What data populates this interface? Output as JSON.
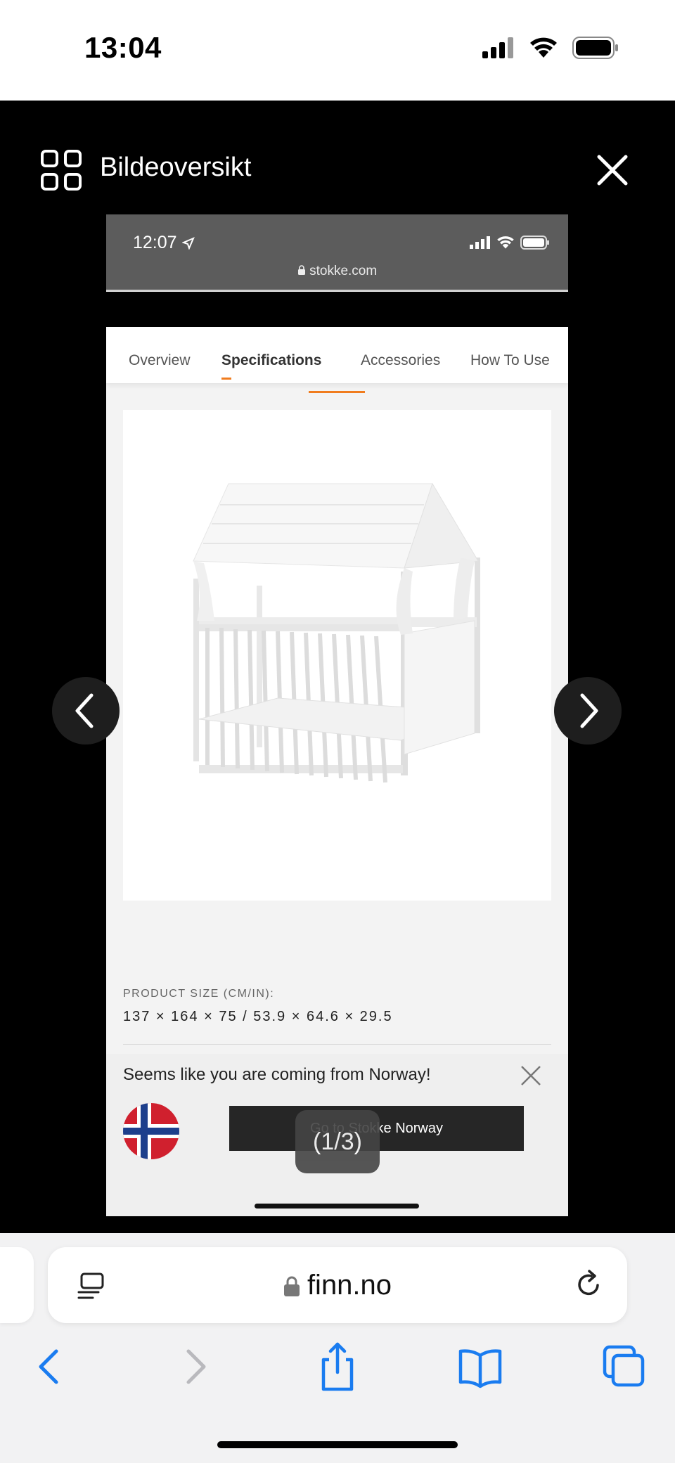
{
  "status_bar": {
    "time": "13:04"
  },
  "gallery": {
    "title": "Bildeoversikt",
    "counter": "(1/3)"
  },
  "screenshot": {
    "status_time": "12:07",
    "url": "stokke.com",
    "tabs": [
      "Overview",
      "Specifications",
      "Accessories",
      "How To Use"
    ],
    "active_tab": "Specifications",
    "spec_label": "PRODUCT SIZE (CM/IN):",
    "spec_value": "137 × 164 × 75 / 53.9 × 64.6 × 29.5",
    "banner_text": "Seems like you are coming from Norway!",
    "banner_button": "Go to Stokke Norway",
    "accent_color": "#f07c1e"
  },
  "browser": {
    "address": "finn.no",
    "toolbar_icons": [
      "back-icon",
      "forward-icon",
      "share-icon",
      "bookmarks-icon",
      "tabs-icon"
    ],
    "accent_color": "#1a7cf0"
  }
}
